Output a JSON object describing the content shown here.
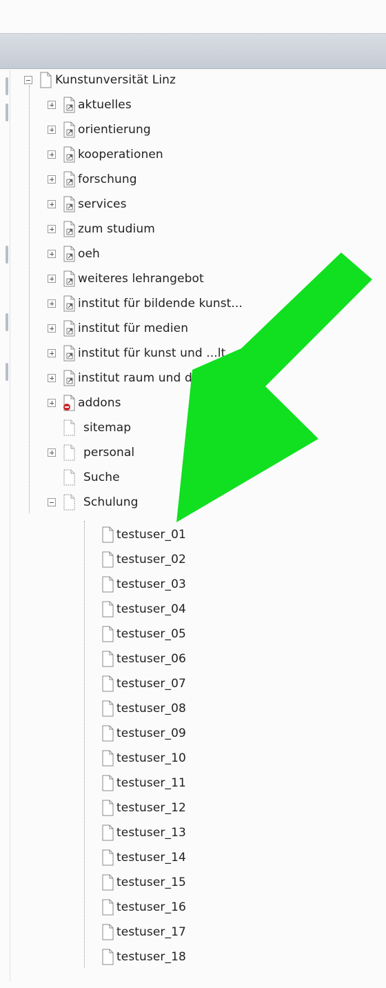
{
  "tree": {
    "root": "Kunstunversität Linz",
    "items": [
      "aktuelles",
      "orientierung",
      "kooperationen",
      "forschung",
      "services",
      "zum studium",
      "oeh",
      "weiteres lehrangebot",
      "institut für bildende kunst...",
      "institut für medien",
      "institut für kunst und ...lt...",
      "institut raum und d...",
      "addons",
      "sitemap",
      "personal",
      "Suche",
      "Schulung"
    ],
    "children": [
      "testuser_01",
      "testuser_02",
      "testuser_03",
      "testuser_04",
      "testuser_05",
      "testuser_06",
      "testuser_07",
      "testuser_08",
      "testuser_09",
      "testuser_10",
      "testuser_11",
      "testuser_12",
      "testuser_13",
      "testuser_14",
      "testuser_15",
      "testuser_16",
      "testuser_17",
      "testuser_18"
    ]
  },
  "colors": {
    "arrow": "#00e000",
    "header": "#cfd4dc",
    "tree_line": "#999999"
  }
}
